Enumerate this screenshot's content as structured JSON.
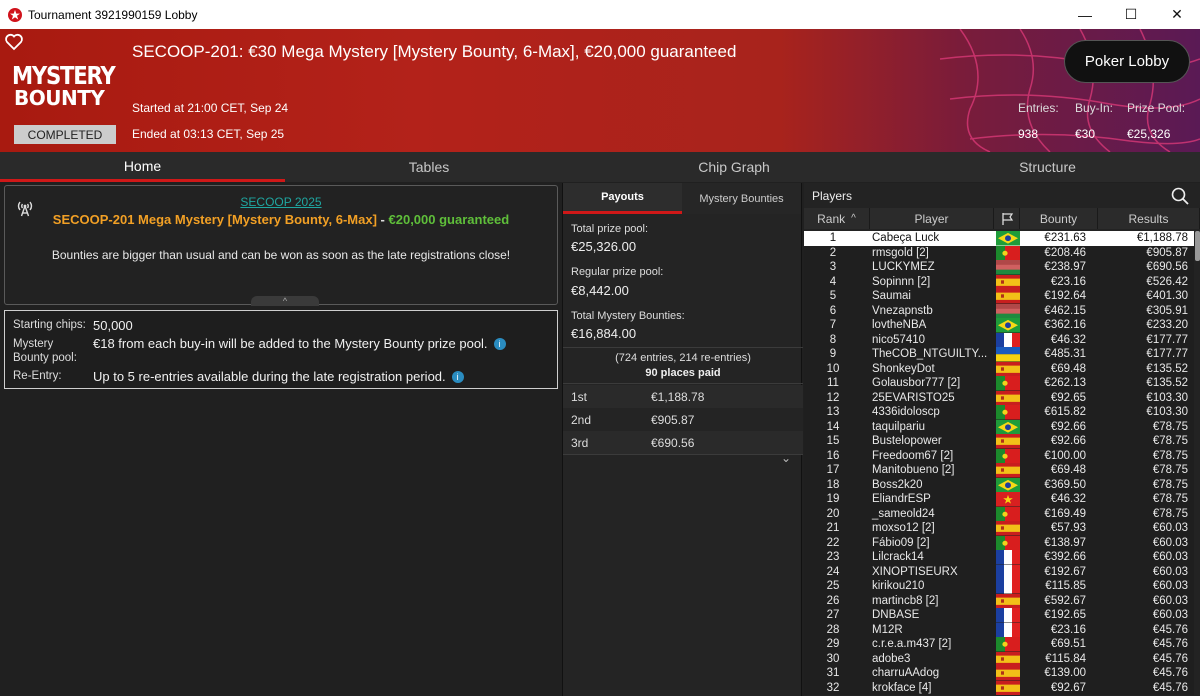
{
  "window": {
    "title": "Tournament 3921990159 Lobby",
    "minimize": "—",
    "maximize": "☐",
    "close": "✕"
  },
  "header": {
    "title": "SECOOP-201: €30 Mega Mystery [Mystery Bounty, 6-Max], €20,000 guaranteed",
    "logo_line1": "MYSTERY",
    "logo_line2": "BOUNTY",
    "status": "COMPLETED",
    "started": "Started at 21:00 CET, Sep 24",
    "ended": "Ended at 03:13 CET, Sep 25",
    "poker_lobby": "Poker Lobby",
    "entries_label": "Entries:",
    "entries_value": "938",
    "buyin_label": "Buy-In:",
    "buyin_value": "€30",
    "prizepool_label": "Prize Pool:",
    "prizepool_value": "€25,326"
  },
  "tabs": [
    "Home",
    "Tables",
    "Chip Graph",
    "Structure"
  ],
  "info": {
    "series": "SECOOP 2025",
    "name": "SECOOP-201 Mega Mystery [Mystery Bounty, 6-Max]",
    "dash": " - ",
    "guarantee": "€20,000 guaranteed",
    "description": "Bounties are bigger than usual and can be won as soon as the late registrations close!",
    "handle": "^"
  },
  "details": {
    "starting_chips_label": "Starting chips:",
    "starting_chips_value": "50,000",
    "mystery_label_1": "Mystery",
    "mystery_label_2": "Bounty pool:",
    "mystery_value": "€18 from each buy-in will be added to the Mystery Bounty prize pool.",
    "reentry_label": "Re-Entry:",
    "reentry_value": "Up to 5 re-entries available during the late registration period.",
    "info_icon": "i"
  },
  "payouts": {
    "tab_payouts": "Payouts",
    "tab_bounties": "Mystery Bounties",
    "total_label": "Total prize pool:",
    "total_value": "€25,326.00",
    "regular_label": "Regular prize pool:",
    "regular_value": "€8,442.00",
    "mystery_label": "Total Mystery Bounties:",
    "mystery_value": "€16,884.00",
    "entries": "(724 entries, 214 re-entries)",
    "places": "90 places paid",
    "rows": [
      {
        "place": "1st",
        "amount": "€1,188.78"
      },
      {
        "place": "2nd",
        "amount": "€905.87"
      },
      {
        "place": "3rd",
        "amount": "€690.56"
      }
    ],
    "expand": "⌄"
  },
  "players": {
    "title": "Players",
    "col_rank": "Rank",
    "sort_icon": "^",
    "col_player": "Player",
    "col_bounty": "Bounty",
    "col_results": "Results",
    "rows": [
      {
        "rank": "1",
        "name": "Cabeça Luck",
        "flag": "br",
        "bounty": "€231.63",
        "result": "€1,188.78"
      },
      {
        "rank": "2",
        "name": "rmsgold [2]",
        "flag": "pt",
        "bounty": "€208.46",
        "result": "€905.87"
      },
      {
        "rank": "3",
        "name": "LUCKYMEZ",
        "flag": "mx",
        "bounty": "€238.97",
        "result": "€690.56"
      },
      {
        "rank": "4",
        "name": "Sopinnn [2]",
        "flag": "es",
        "bounty": "€23.16",
        "result": "€526.42"
      },
      {
        "rank": "5",
        "name": "Saumai",
        "flag": "es",
        "bounty": "€192.64",
        "result": "€401.30"
      },
      {
        "rank": "6",
        "name": "Vnezapnstb",
        "flag": "mx",
        "bounty": "€462.15",
        "result": "€305.91"
      },
      {
        "rank": "7",
        "name": "lovtheNBA",
        "flag": "br",
        "bounty": "€362.16",
        "result": "€233.20"
      },
      {
        "rank": "8",
        "name": "nico57410",
        "flag": "fr",
        "bounty": "€46.32",
        "result": "€177.77"
      },
      {
        "rank": "9",
        "name": "TheCOB_NTGUILTY...",
        "flag": "ua",
        "bounty": "€485.31",
        "result": "€177.77"
      },
      {
        "rank": "10",
        "name": "ShonkeyDot",
        "flag": "es",
        "bounty": "€69.48",
        "result": "€135.52"
      },
      {
        "rank": "11",
        "name": "Golausbor777 [2]",
        "flag": "pt",
        "bounty": "€262.13",
        "result": "€135.52"
      },
      {
        "rank": "12",
        "name": "25EVARISTO25",
        "flag": "es",
        "bounty": "€92.65",
        "result": "€103.30"
      },
      {
        "rank": "13",
        "name": "4336idoloscp",
        "flag": "pt",
        "bounty": "€615.82",
        "result": "€103.30"
      },
      {
        "rank": "14",
        "name": "taquilpariu",
        "flag": "br",
        "bounty": "€92.66",
        "result": "€78.75"
      },
      {
        "rank": "15",
        "name": "Bustelopower",
        "flag": "es",
        "bounty": "€92.66",
        "result": "€78.75"
      },
      {
        "rank": "16",
        "name": "Freedoom67 [2]",
        "flag": "pt",
        "bounty": "€100.00",
        "result": "€78.75"
      },
      {
        "rank": "17",
        "name": "Manitobueno [2]",
        "flag": "es",
        "bounty": "€69.48",
        "result": "€78.75"
      },
      {
        "rank": "18",
        "name": "Boss2k20",
        "flag": "br",
        "bounty": "€369.50",
        "result": "€78.75"
      },
      {
        "rank": "19",
        "name": "EliandrESP",
        "flag": "cn",
        "bounty": "€46.32",
        "result": "€78.75"
      },
      {
        "rank": "20",
        "name": "_sameold24",
        "flag": "pt",
        "bounty": "€169.49",
        "result": "€78.75"
      },
      {
        "rank": "21",
        "name": "moxso12 [2]",
        "flag": "es",
        "bounty": "€57.93",
        "result": "€60.03"
      },
      {
        "rank": "22",
        "name": "Fábio09 [2]",
        "flag": "pt",
        "bounty": "€138.97",
        "result": "€60.03"
      },
      {
        "rank": "23",
        "name": "Lilcrack14",
        "flag": "fr",
        "bounty": "€392.66",
        "result": "€60.03"
      },
      {
        "rank": "24",
        "name": "XINOPTISEURX",
        "flag": "fr",
        "bounty": "€192.67",
        "result": "€60.03"
      },
      {
        "rank": "25",
        "name": "kirikou210",
        "flag": "fr",
        "bounty": "€115.85",
        "result": "€60.03"
      },
      {
        "rank": "26",
        "name": "martincb8 [2]",
        "flag": "es",
        "bounty": "€592.67",
        "result": "€60.03"
      },
      {
        "rank": "27",
        "name": "DNBASE",
        "flag": "fr",
        "bounty": "€192.65",
        "result": "€60.03"
      },
      {
        "rank": "28",
        "name": "M12R",
        "flag": "fr",
        "bounty": "€23.16",
        "result": "€45.76"
      },
      {
        "rank": "29",
        "name": "c.r.e.a.m437 [2]",
        "flag": "pt",
        "bounty": "€69.51",
        "result": "€45.76"
      },
      {
        "rank": "30",
        "name": "adobe3",
        "flag": "es",
        "bounty": "€115.84",
        "result": "€45.76"
      },
      {
        "rank": "31",
        "name": "charruAAdog",
        "flag": "es",
        "bounty": "€139.00",
        "result": "€45.76"
      },
      {
        "rank": "32",
        "name": "krokface [4]",
        "flag": "es",
        "bounty": "€92.67",
        "result": "€45.76"
      }
    ]
  },
  "colors": {
    "accent_red": "#d01818",
    "guarantee_green": "#5fbf3a",
    "name_orange": "#f2a025",
    "link_teal": "#1fa7a1"
  }
}
